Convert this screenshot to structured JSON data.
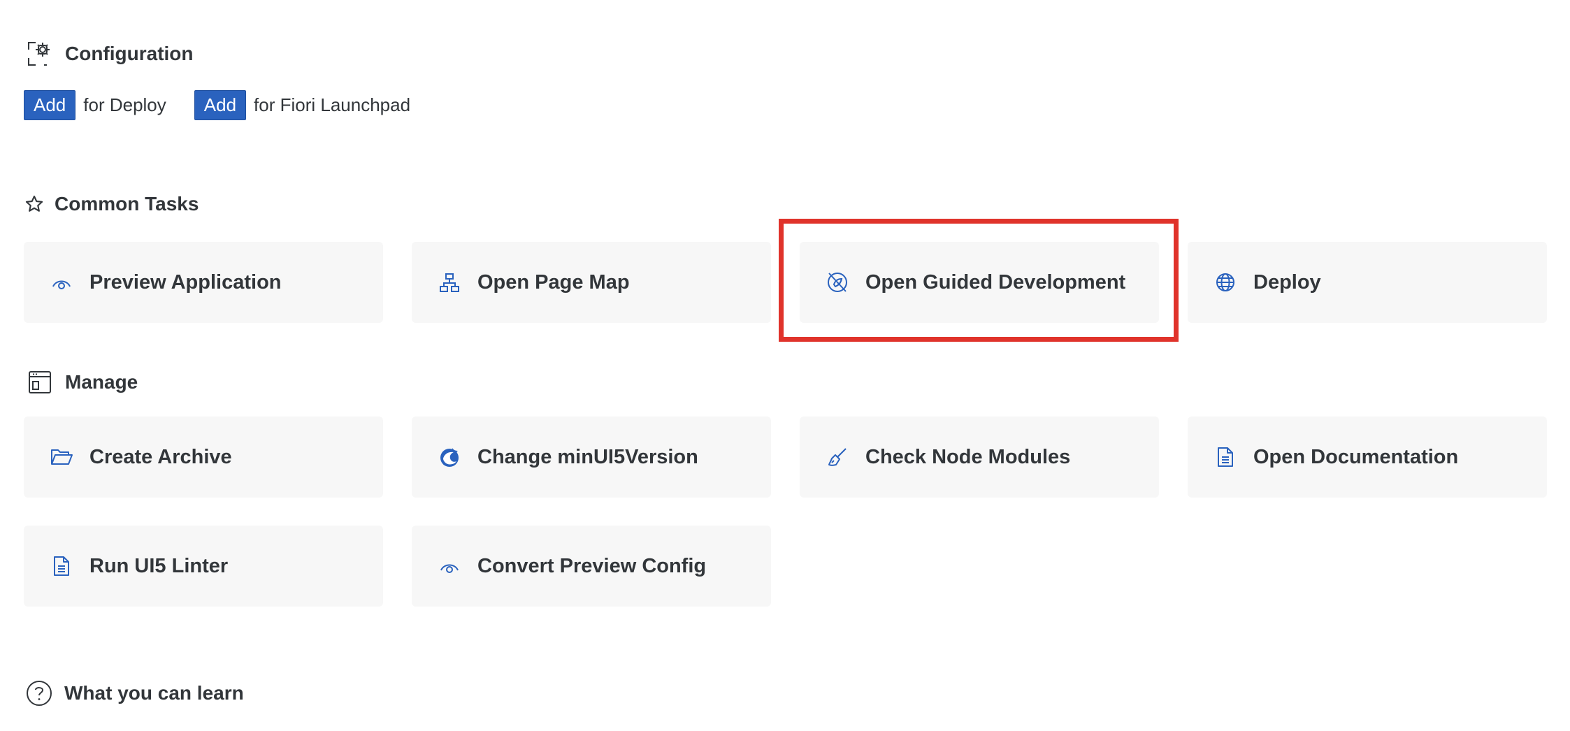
{
  "configuration": {
    "title": "Configuration",
    "icon": "settings-gear-icon",
    "actions": [
      {
        "button": "Add",
        "label": "for Deploy"
      },
      {
        "button": "Add",
        "label": "for Fiori Launchpad"
      }
    ]
  },
  "common_tasks": {
    "title": "Common Tasks",
    "icon": "star-icon",
    "items": [
      {
        "label": "Preview Application",
        "icon": "eye-preview-icon"
      },
      {
        "label": "Open Page Map",
        "icon": "sitemap-icon"
      },
      {
        "label": "Open Guided Development",
        "icon": "guided-development-icon"
      },
      {
        "label": "Deploy",
        "icon": "globe-icon"
      }
    ]
  },
  "manage": {
    "title": "Manage",
    "icon": "window-icon",
    "items": [
      {
        "label": "Create Archive",
        "icon": "open-folder-icon"
      },
      {
        "label": "Change minUI5Version",
        "icon": "ui5-logo-icon"
      },
      {
        "label": "Check Node Modules",
        "icon": "broom-icon"
      },
      {
        "label": "Open Documentation",
        "icon": "document-icon"
      },
      {
        "label": "Run UI5 Linter",
        "icon": "document-text-icon"
      },
      {
        "label": "Convert Preview Config",
        "icon": "eye-preview-icon"
      }
    ]
  },
  "learn": {
    "title": "What you can learn",
    "icon": "question-circle-icon"
  },
  "colors": {
    "accent": "#2a62be",
    "tile_background": "#f7f7f7",
    "text": "#32363a",
    "highlight": "#e0332b"
  }
}
